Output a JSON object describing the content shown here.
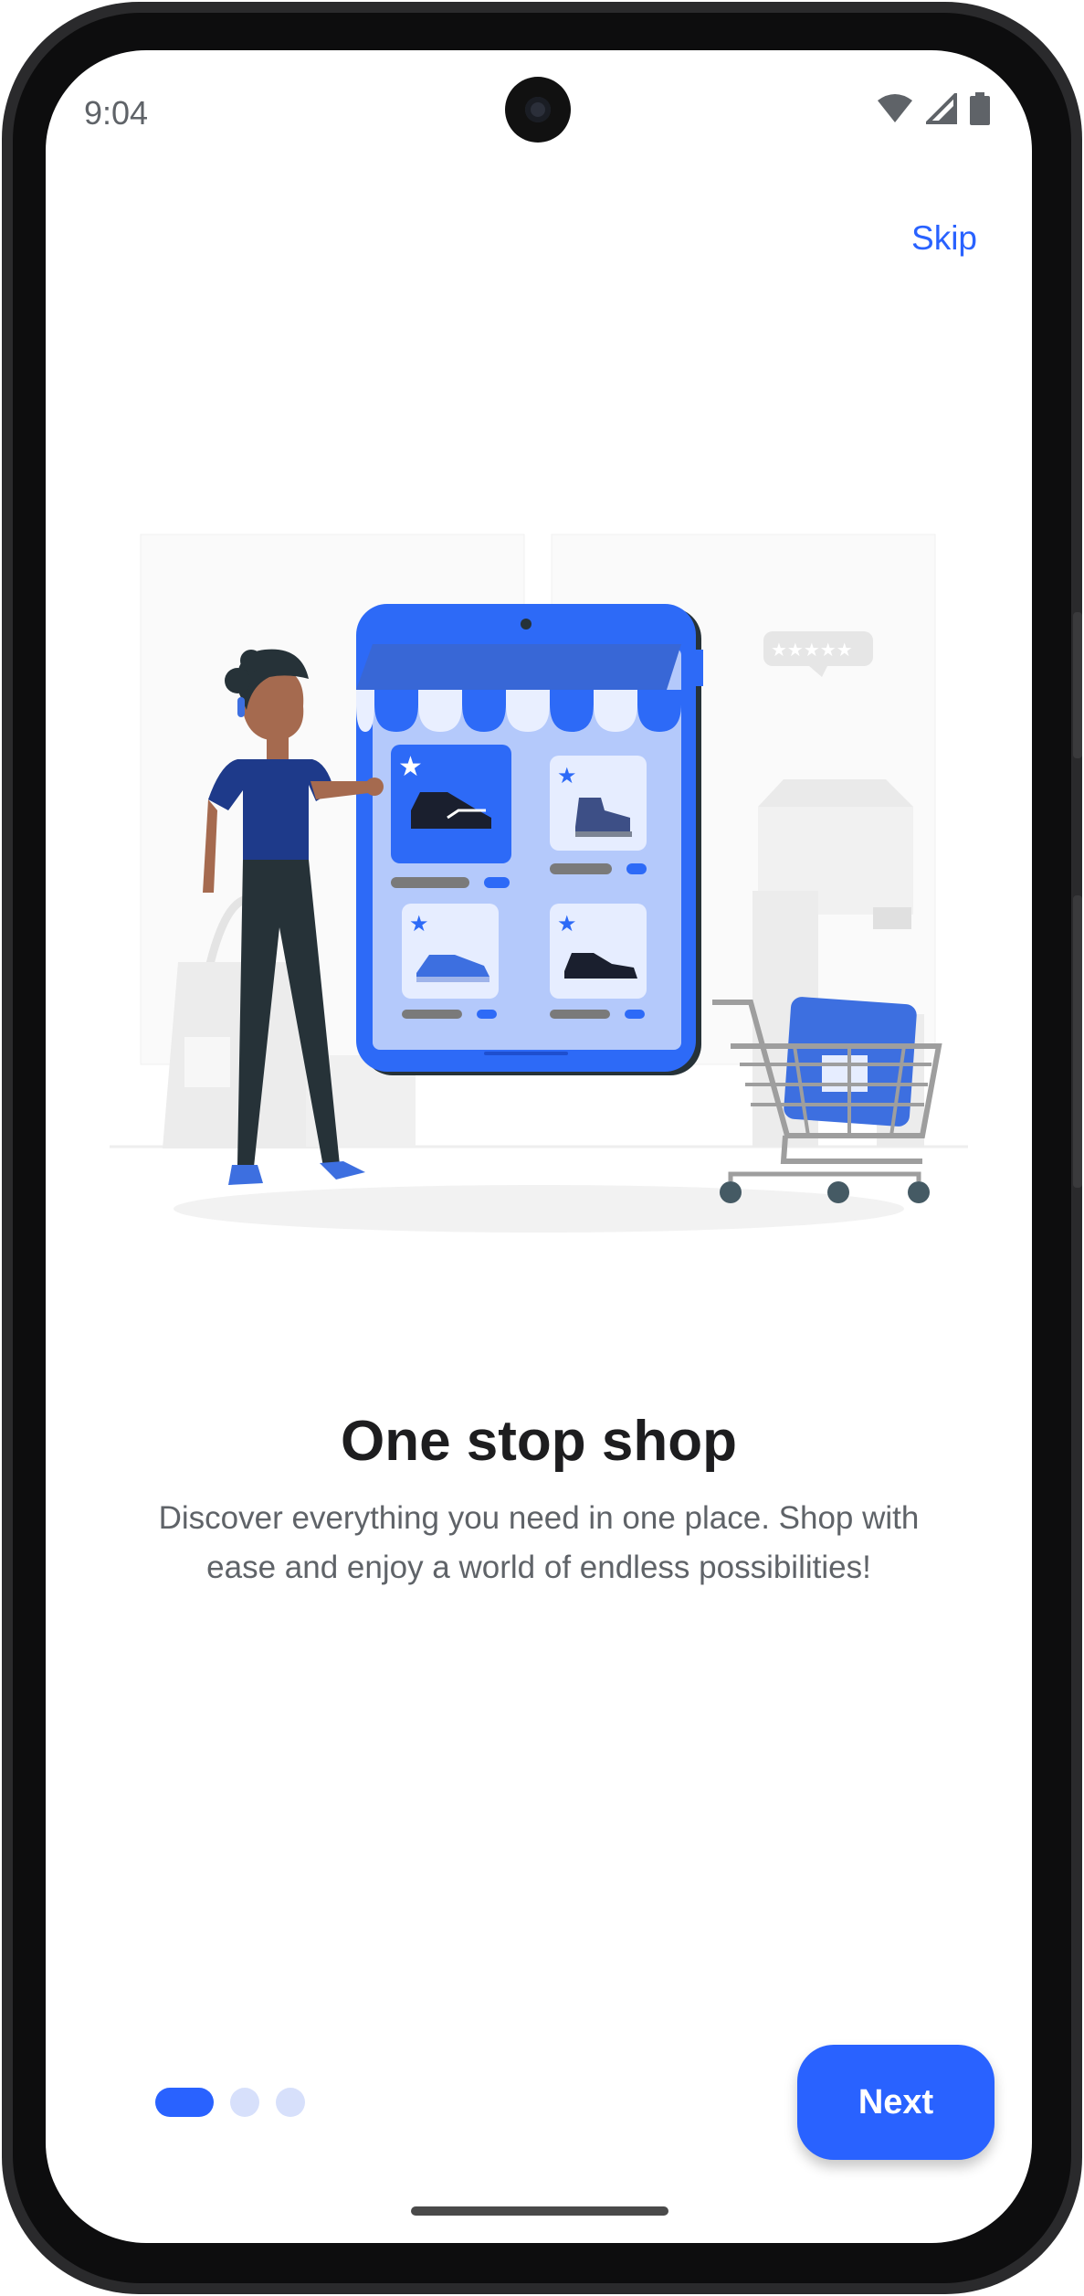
{
  "status_bar": {
    "time": "9:04"
  },
  "onboarding": {
    "skip_label": "Skip",
    "title": "One stop shop",
    "description": "Discover everything you need in one place. Shop with ease and enjoy a world of endless possibilities!",
    "next_label": "Next",
    "page_indicator": {
      "current": 1,
      "total": 3
    }
  },
  "colors": {
    "accent": "#2962ff",
    "dot_inactive": "#d7e0fb",
    "title": "#1d1d1f",
    "body_text": "#5f6368"
  },
  "icons": [
    "wifi-icon",
    "cell-signal-icon",
    "battery-icon",
    "camera-icon"
  ]
}
